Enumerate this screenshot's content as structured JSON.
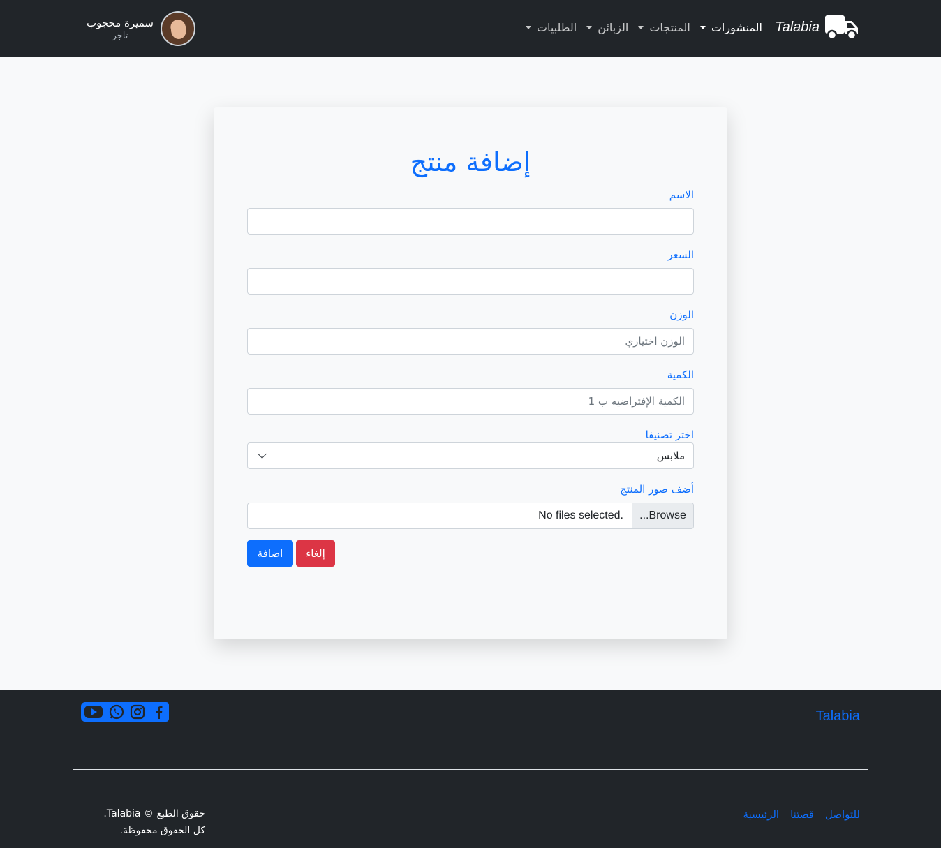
{
  "navbar": {
    "brand": "Talabia",
    "menu": [
      {
        "label": "المنشورات",
        "active": true
      },
      {
        "label": "المنتجات",
        "active": false
      },
      {
        "label": "الزبائن",
        "active": false
      },
      {
        "label": "الطلبيات",
        "active": false
      }
    ],
    "user": {
      "name": "سميرة محجوب",
      "role": "تاجر"
    }
  },
  "form": {
    "title": "إضافة منتج",
    "name_label": "الاسم",
    "price_label": "السعر",
    "weight_label": "الوزن",
    "weight_placeholder": "الوزن اختياري",
    "quantity_label": "الكمية",
    "quantity_placeholder": "الكمية الإفتراضيه ب 1",
    "category_label": "اختر تصنيفا",
    "category_value": "ملابس",
    "images_label": "أضف صور المنتج",
    "browse_label": "Browse...",
    "file_status": "No files selected.",
    "submit_label": "اضافة",
    "cancel_label": "إلغاء"
  },
  "footer": {
    "brand": "Talabia",
    "social": [
      "youtube-icon",
      "whatsapp-icon",
      "instagram-icon",
      "facebook-icon"
    ],
    "copyright_line1": "حقوق الطبع © Talabia.",
    "copyright_line2": "كل الحقوق محفوظة.",
    "links": [
      "الرئيسية",
      "قصتنا",
      "للتواصل"
    ]
  },
  "colors": {
    "primary": "#0d6efd",
    "danger": "#dc3545",
    "dark": "#212529",
    "light": "#f8f9fa"
  }
}
